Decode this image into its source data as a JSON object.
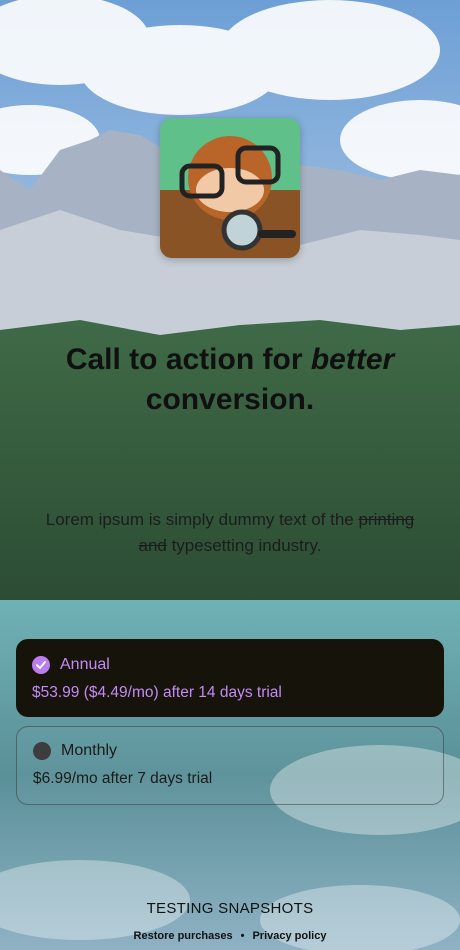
{
  "app_icon": "magnifier-character-icon",
  "headline": {
    "part1": "Call to action for ",
    "emphasis": "better",
    "part2": "conversion."
  },
  "subtitle": {
    "part1": "Lorem ipsum is simply dummy text of the ",
    "struck": "printing and",
    "part2": " typesetting industry."
  },
  "plans": [
    {
      "name": "Annual",
      "price": "$53.99 ($4.49/mo) after 14 days trial",
      "selected": true
    },
    {
      "name": "Monthly",
      "price": "$6.99/mo after 7 days trial",
      "selected": false
    }
  ],
  "footer": {
    "title": "TESTING SNAPSHOTS",
    "restore": "Restore purchases",
    "separator": "•",
    "privacy": "Privacy policy"
  },
  "colors": {
    "accent": "#b97df0",
    "selected_bg": "#15130a"
  }
}
